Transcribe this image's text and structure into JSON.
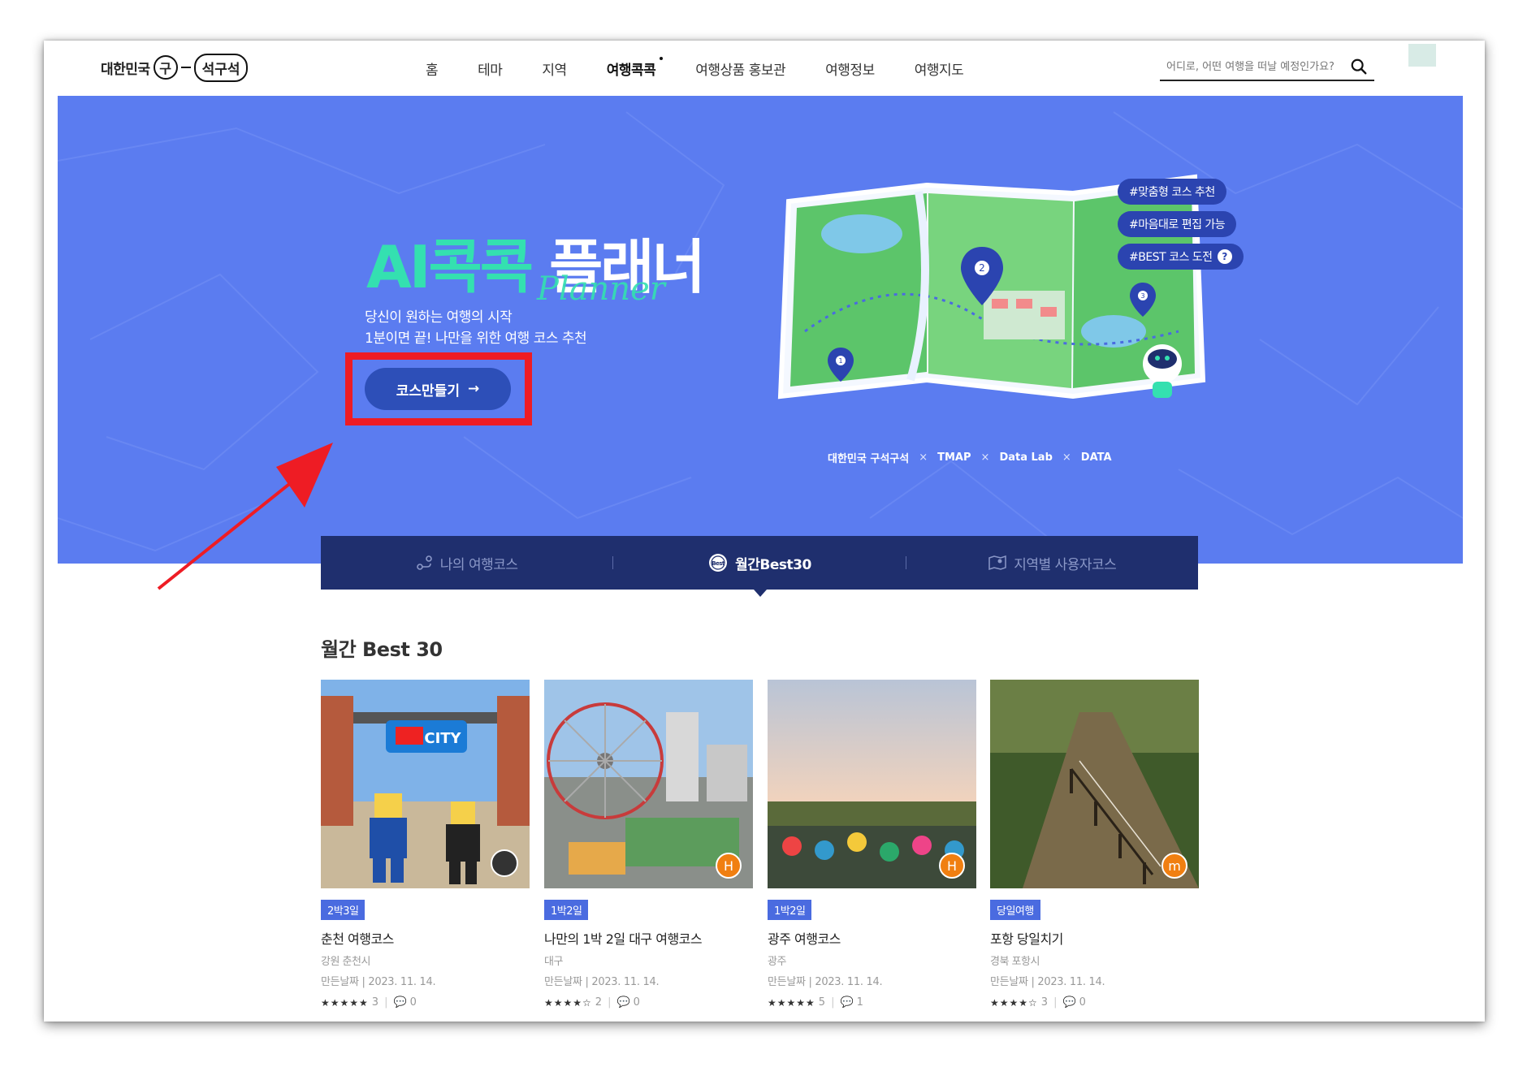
{
  "header": {
    "logo": {
      "prefix": "대한민국",
      "circle": "구",
      "suffix": "석구석"
    },
    "nav": [
      {
        "label": "홈"
      },
      {
        "label": "테마"
      },
      {
        "label": "지역"
      },
      {
        "label": "여행콕콕"
      },
      {
        "label": "여행상품 홍보관"
      },
      {
        "label": "여행정보"
      },
      {
        "label": "여행지도"
      }
    ],
    "search_placeholder": "어디로, 어떤 여행을 떠날 예정인가요?"
  },
  "hero": {
    "title_ai": "AI콕콕",
    "title_planner": " 플래너",
    "script": "Planner",
    "desc1": "당신이 원하는 여행의 시작",
    "desc2": "1분이면 끝! 나만을 위한 여행 코스 추천",
    "button_label": "코스만들기",
    "button_arrow": "→",
    "hashtags": [
      "#맞춤형 코스 추천",
      "#마음대로 편집 가능",
      "#BEST 코스 도전"
    ],
    "hashtag_help": "?",
    "partners": [
      "대한민국 구석구석",
      "TMAP",
      "Data Lab",
      "DATA"
    ],
    "map_pins": [
      "1",
      "2",
      "3"
    ],
    "colors": {
      "background": "#5b7cf0",
      "accent": "#34e0b0",
      "button": "#2d4fb8"
    }
  },
  "tabs": [
    {
      "label": "나의 여행코스",
      "icon": "route-icon"
    },
    {
      "label": "월간Best30",
      "icon": "best-badge-icon"
    },
    {
      "label": "지역별 사용자코스",
      "icon": "map-pin-icon"
    }
  ],
  "section_title": "월간 Best 30",
  "cards": [
    {
      "badge": "2박3일",
      "title": "춘천 여행코스",
      "region": "강원 춘천시",
      "date": "만든날짜  |  2023. 11. 14.",
      "rating": 5,
      "stars": "★★★★★",
      "likes": "3",
      "comments": "0",
      "avatar": ""
    },
    {
      "badge": "1박2일",
      "title": "나만의 1박 2일 대구 여행코스",
      "region": "대구",
      "date": "만든날짜  |  2023. 11. 14.",
      "rating": 4.5,
      "stars": "★★★★☆",
      "likes": "2",
      "comments": "0",
      "avatar": "H"
    },
    {
      "badge": "1박2일",
      "title": "광주 여행코스",
      "region": "광주",
      "date": "만든날짜  |  2023. 11. 14.",
      "rating": 5,
      "stars": "★★★★★",
      "likes": "5",
      "comments": "1",
      "avatar": "H"
    },
    {
      "badge": "당일여행",
      "title": "포항 당일치기",
      "region": "경북 포항시",
      "date": "만든날짜  |  2023. 11. 14.",
      "rating": 4.5,
      "stars": "★★★★☆",
      "likes": "3",
      "comments": "0",
      "avatar": "m"
    }
  ]
}
